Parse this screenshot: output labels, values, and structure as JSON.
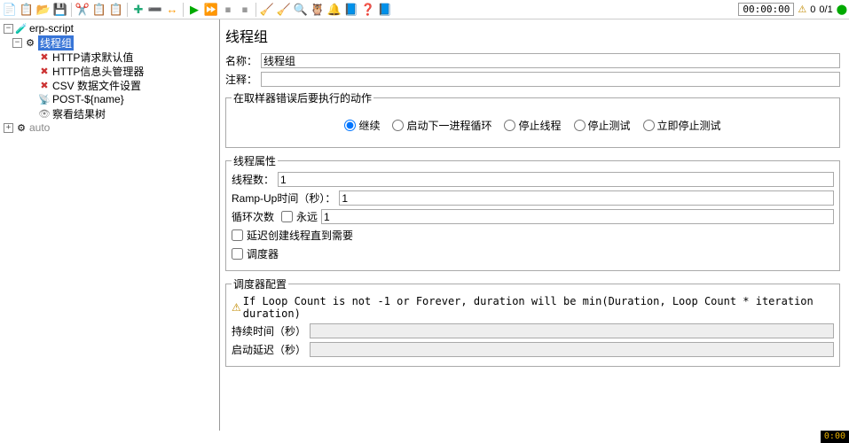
{
  "toolbar": {
    "timer": "00:00:00",
    "counter": "0/1",
    "warn_count": "0"
  },
  "tree": {
    "root": "erp-script",
    "group": "线程组",
    "children": [
      "HTTP请求默认值",
      "HTTP信息头管理器",
      "CSV 数据文件设置",
      "POST-${name}",
      "察看结果树"
    ],
    "auto": "auto"
  },
  "panel": {
    "title": "线程组",
    "name_label": "名称：",
    "name_value": "线程组",
    "comment_label": "注释：",
    "onerror_legend": "在取样器错误后要执行的动作",
    "radios": {
      "continue": "继续",
      "start_next": "启动下一进程循环",
      "stop_thread": "停止线程",
      "stop_test": "停止测试",
      "stop_test_now": "立即停止测试"
    },
    "props_legend": "线程属性",
    "threads_label": "线程数：",
    "threads_value": "1",
    "rampup_label": "Ramp-Up时间（秒）：",
    "rampup_value": "1",
    "loop_label": "循环次数",
    "forever_label": "永远",
    "loop_value": "1",
    "delay_create_label": "延迟创建线程直到需要",
    "scheduler_label": "调度器",
    "scheduler_legend": "调度器配置",
    "scheduler_warn": "If Loop Count is not -1 or Forever, duration will be min(Duration, Loop Count * iteration duration)",
    "duration_label": "持续时间（秒）",
    "startup_delay_label": "启动延迟（秒）"
  },
  "footer": {
    "time": "0:00"
  }
}
